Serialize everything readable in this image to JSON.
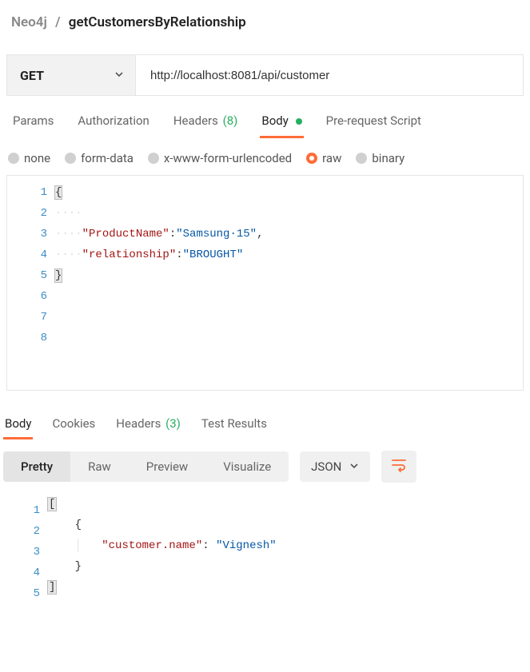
{
  "breadcrumb": {
    "root": "Neo4j",
    "sep": "/",
    "leaf": "getCustomersByRelationship"
  },
  "request": {
    "method": "GET",
    "url": "http://localhost:8081/api/customer"
  },
  "req_tabs": {
    "params": "Params",
    "auth": "Authorization",
    "headers_label": "Headers",
    "headers_count": "(8)",
    "body": "Body",
    "prerequest": "Pre-request Script"
  },
  "body_types": {
    "none": "none",
    "formdata": "form-data",
    "urlencoded": "x-www-form-urlencoded",
    "raw": "raw",
    "binary": "binary"
  },
  "body_editor": {
    "lines": [
      "1",
      "2",
      "3",
      "4",
      "5",
      "6",
      "7",
      "8"
    ],
    "code": {
      "open_brace": "{",
      "line2_ws": "····",
      "line3_ws": "····",
      "line3_key": "\"ProductName\"",
      "line3_colon": ":",
      "line3_val": "\"Samsung·15\"",
      "line3_comma": ",",
      "line4_ws": "····",
      "line4_key": "\"relationship\"",
      "line4_colon": ":",
      "line4_val": "\"BROUGHT\"",
      "close_brace": "}"
    }
  },
  "resp_tabs": {
    "body": "Body",
    "cookies": "Cookies",
    "headers_label": "Headers",
    "headers_count": "(3)",
    "tests": "Test Results"
  },
  "view_modes": {
    "pretty": "Pretty",
    "raw": "Raw",
    "preview": "Preview",
    "visualize": "Visualize"
  },
  "format_select": "JSON",
  "response": {
    "lines": [
      "1",
      "2",
      "3",
      "4",
      "5"
    ],
    "open_bracket": "[",
    "obj_open": "{",
    "key": "\"customer.name\"",
    "colon": ": ",
    "value": "\"Vignesh\"",
    "obj_close": "}",
    "close_bracket": "]"
  }
}
